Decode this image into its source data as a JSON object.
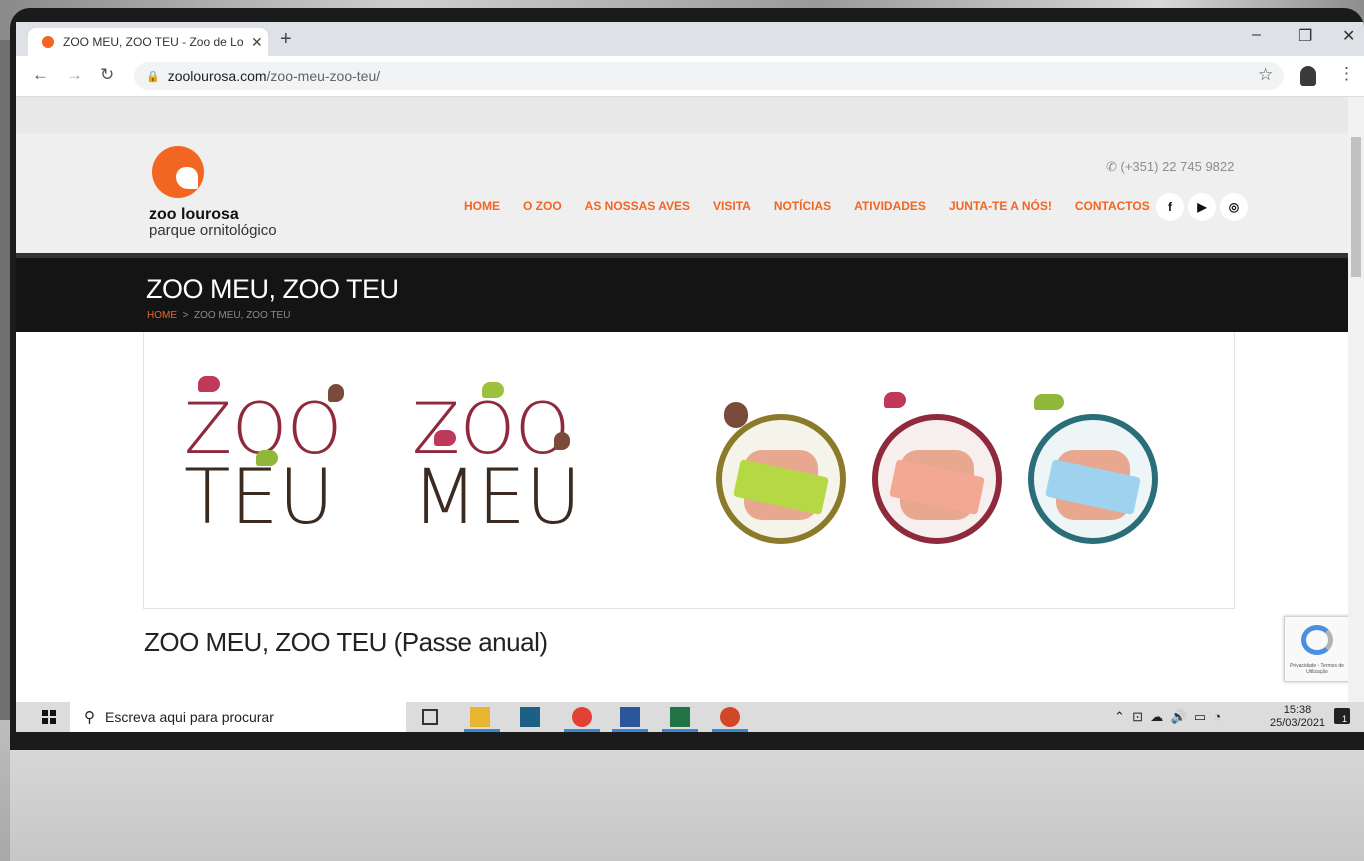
{
  "browser": {
    "tab_title": "ZOO MEU, ZOO TEU - Zoo de Lo",
    "url_domain": "zoolourosa.com",
    "url_path": "/zoo-meu-zoo-teu/"
  },
  "site": {
    "logo_name": "zoo lourosa",
    "logo_sub": "parque ornitológico",
    "phone": "(+351) 22 745 9822",
    "nav": [
      "HOME",
      "O ZOO",
      "AS NOSSAS AVES",
      "VISITA",
      "NOTÍCIAS",
      "ATIVIDADES",
      "JUNTA-TE A NÓS!",
      "CONTACTOS"
    ],
    "social_icons": [
      "facebook-icon",
      "youtube-icon",
      "instagram-icon"
    ],
    "accent_color": "#f26522"
  },
  "page": {
    "title": "ZOO MEU, ZOO TEU",
    "breadcrumb_home": "HOME",
    "breadcrumb_sep": ">",
    "breadcrumb_current": "ZOO MEU, ZOO TEU",
    "banner_words": {
      "left_top": "ZOO",
      "left_bottom": "TEU",
      "right_top": "ZOO",
      "right_bottom": "MEU"
    },
    "subtitle": "ZOO MEU, ZOO TEU (Passe anual)"
  },
  "recaptcha": {
    "text": "Privacidade - Termos de Utilização"
  },
  "taskbar": {
    "search_placeholder": "Escreva aqui para procurar",
    "time": "15:38",
    "date": "25/03/2021",
    "notification_count": "1"
  }
}
